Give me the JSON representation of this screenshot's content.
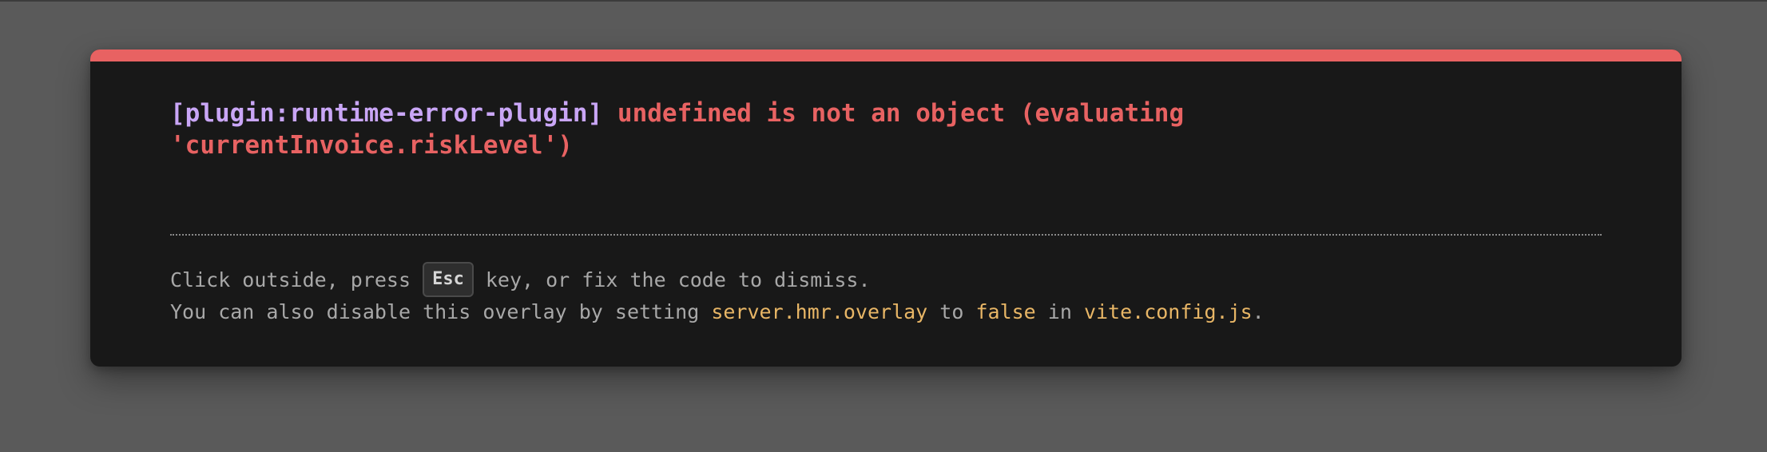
{
  "overlay": {
    "plugin_label": "[plugin:runtime-error-plugin]",
    "error_message": "undefined is not an object (evaluating\n'currentInvoice.riskLevel')",
    "tip1_before": "Click outside, press ",
    "tip1_key": "Esc",
    "tip1_after": " key, or fix the code to dismiss.",
    "tip2_part1": "You can also disable this overlay by setting ",
    "tip2_code1": "server.hmr.overlay",
    "tip2_part2": " to ",
    "tip2_code2": "false",
    "tip2_part3": " in ",
    "tip2_code3": "vite.config.js",
    "tip2_part4": "."
  },
  "colors": {
    "accent_red": "#e86262",
    "plugin_purple": "#c9a6f6",
    "code_yellow": "#e8b666",
    "overlay_bg": "#181818",
    "backdrop": "#5a5a5a"
  }
}
